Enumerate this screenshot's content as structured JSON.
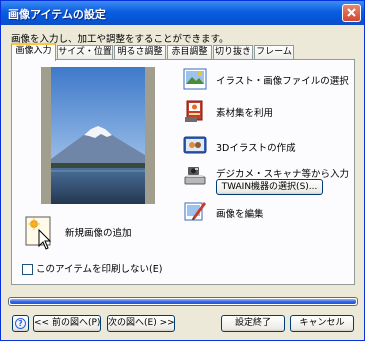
{
  "window": {
    "title": "画像アイテムの設定",
    "description": "画像を入力し、加工や調整をすることができます。"
  },
  "tabs": [
    {
      "label": "画像入力",
      "active": true
    },
    {
      "label": "サイズ・位置",
      "active": false
    },
    {
      "label": "明るさ調整",
      "active": false
    },
    {
      "label": "赤目調整",
      "active": false
    },
    {
      "label": "切り抜き",
      "active": false
    },
    {
      "label": "フレーム",
      "active": false
    }
  ],
  "actions": {
    "illust_file": {
      "label": "イラスト・画像ファイルの選択",
      "icon": "image-file-icon"
    },
    "material": {
      "label": "素材集を利用",
      "icon": "material-collection-icon"
    },
    "create_3d": {
      "label": "3Dイラストの作成",
      "icon": "3d-illustration-icon"
    },
    "digicam": {
      "label": "デジカメ・スキャナ等から入力",
      "icon": "camera-scanner-icon"
    },
    "twain_button": "TWAIN機器の選択(S)...",
    "edit_image": {
      "label": "画像を編集",
      "icon": "edit-image-icon"
    }
  },
  "new_image": {
    "label": "新規画像の追加",
    "icon": "new-image-icon"
  },
  "no_print_checkbox": {
    "label": "このアイテムを印刷しない(E)",
    "checked": false
  },
  "progress": {
    "fraction": 1.0
  },
  "footer": {
    "prev_button": "<< 前の図へ(P)",
    "next_button": "次の図へ(E) >>",
    "finish_button": "設定終了",
    "cancel_button": "キャンセル",
    "help_button": "?"
  },
  "colors": {
    "title_bar": "#0a5ee0",
    "window_bg": "#ece9d8",
    "panel_bg": "#fcfcfe",
    "active_tab_accent": "#ffc83c",
    "progress_fill": "#2b5ee3",
    "close_button": "#d4452c"
  }
}
